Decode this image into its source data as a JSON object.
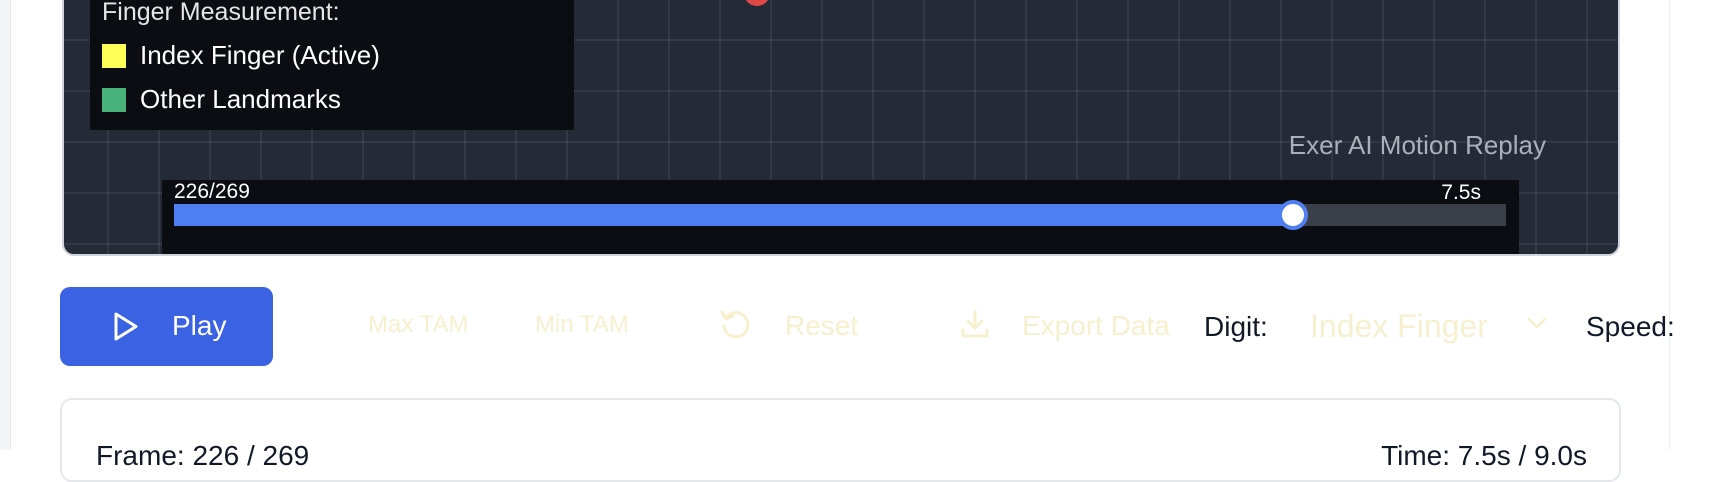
{
  "viewer": {
    "legend": {
      "title": "Finger Measurement:",
      "items": [
        {
          "label": "Index Finger (Active)",
          "color": "#ffff55"
        },
        {
          "label": "Other Landmarks",
          "color": "#4ab37c"
        }
      ]
    },
    "replay_title": "Exer AI Motion Replay",
    "scrubber": {
      "frame_text": "226/269",
      "time_text": "7.5s",
      "progress": 0.8402
    }
  },
  "controls": {
    "play_label": "Play",
    "max_tam_label": "Max TAM",
    "min_tam_label": "Min TAM",
    "reset_label": "Reset",
    "export_label": "Export Data",
    "digit_label": "Digit:",
    "digit_value": "Index Finger",
    "speed_label": "Speed:"
  },
  "info": {
    "frame_text": "Frame: 226 / 269",
    "time_text": "Time: 7.5s / 9.0s"
  },
  "colors": {
    "primary": "#3a62e3",
    "progress": "#4f7ff0",
    "muted_control": "#f6f0cf",
    "landmark": "#e04848"
  },
  "icons": [
    "play-icon",
    "reset-icon",
    "download-icon",
    "chevron-down-icon"
  ]
}
